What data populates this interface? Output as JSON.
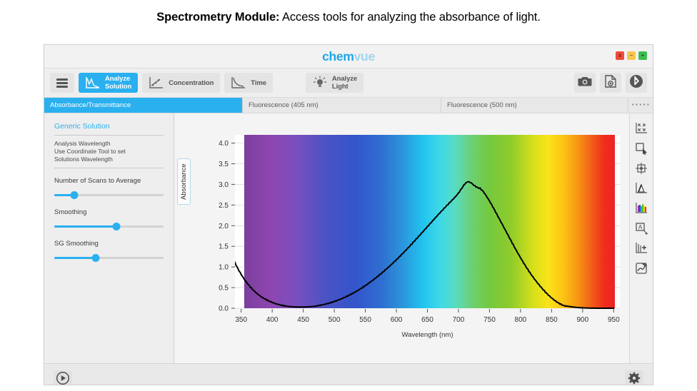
{
  "caption": {
    "bold": "Spectrometry Module:",
    "rest": " Access tools for analyzing the absorbance of light."
  },
  "window": {
    "brand_part1": "chem",
    "brand_part2": "vue",
    "controls": {
      "close": "x",
      "minimize": "–",
      "maximize": "+"
    }
  },
  "toolbar": {
    "menu_label": "",
    "buttons": [
      {
        "label": "Analyze\nSolution",
        "icon": "absorbance-curve-icon",
        "active": true
      },
      {
        "label": "Concentration",
        "icon": "scatter-trend-icon",
        "active": false
      },
      {
        "label": "Time",
        "icon": "decay-curve-icon",
        "active": false
      },
      {
        "label": "Analyze\nLight",
        "icon": "lightbulb-icon",
        "active": false
      }
    ],
    "right_buttons": [
      {
        "name": "camera-icon",
        "label": ""
      },
      {
        "name": "document-camera-icon",
        "label": ""
      },
      {
        "name": "bluetooth-icon",
        "label": ""
      }
    ]
  },
  "tabs": [
    {
      "label": "Absorbance/Transmittance",
      "active": true
    },
    {
      "label": "Fluorescence (405 nm)",
      "active": false
    },
    {
      "label": "Fluorescence (500 nm)",
      "active": false
    }
  ],
  "tab_grip": "▪▪▪▪▪",
  "sidebar": {
    "title": "Generic Solution",
    "note": "Analysis Wavelength\nUse Coordinate Tool to  set\nSolutions Wavelength",
    "sliders": [
      {
        "label": "Number of Scans to Average",
        "value": 18
      },
      {
        "label": "Smoothing",
        "value": 57
      },
      {
        "label": "SG Smoothing",
        "value": 38
      }
    ]
  },
  "rail": [
    {
      "name": "zoom-extents-icon"
    },
    {
      "name": "select-region-icon"
    },
    {
      "name": "coordinate-tool-icon"
    },
    {
      "name": "peak-analysis-icon"
    },
    {
      "name": "spectrum-bars-icon"
    },
    {
      "name": "annotation-icon"
    },
    {
      "name": "add-axis-icon"
    },
    {
      "name": "export-graph-icon"
    }
  ],
  "statusbar": {
    "play_label": "",
    "settings_label": ""
  },
  "chart_data": {
    "type": "line",
    "title": "",
    "xlabel": "Wavelength (nm)",
    "ylabel": "Absorbance",
    "xlim": [
      340,
      960
    ],
    "ylim": [
      0.0,
      4.2
    ],
    "xticks": [
      350,
      400,
      450,
      500,
      550,
      600,
      650,
      700,
      750,
      800,
      850,
      900,
      950
    ],
    "yticks": [
      "0.0",
      "0.5",
      "1.0",
      "1.5",
      "2.0",
      "2.5",
      "3.0",
      "3.5",
      "4.0"
    ],
    "grid": false,
    "legend": "none",
    "background": "visible-spectrum-gradient",
    "spectrum_span_nm": [
      352,
      952
    ],
    "series": [
      {
        "name": "Absorbance",
        "color": "#000000",
        "x": [
          340,
          345,
          350,
          355,
          360,
          365,
          370,
          375,
          380,
          385,
          390,
          395,
          400,
          405,
          410,
          415,
          420,
          425,
          430,
          435,
          440,
          445,
          450,
          455,
          460,
          465,
          470,
          475,
          480,
          485,
          490,
          495,
          500,
          505,
          510,
          515,
          520,
          525,
          530,
          535,
          540,
          545,
          550,
          555,
          560,
          565,
          570,
          575,
          580,
          585,
          590,
          595,
          600,
          605,
          610,
          615,
          620,
          625,
          630,
          635,
          640,
          645,
          650,
          655,
          660,
          665,
          670,
          675,
          680,
          685,
          690,
          695,
          700,
          705,
          710,
          715,
          720,
          725,
          730,
          735,
          740,
          745,
          750,
          755,
          760,
          765,
          770,
          775,
          780,
          785,
          790,
          795,
          800,
          805,
          810,
          815,
          820,
          825,
          830,
          835,
          840,
          845,
          850,
          855,
          860,
          865,
          870,
          880,
          890,
          900,
          910,
          920,
          930,
          940,
          950
        ],
        "y": [
          1.1,
          0.95,
          0.82,
          0.7,
          0.6,
          0.51,
          0.43,
          0.36,
          0.3,
          0.25,
          0.21,
          0.17,
          0.14,
          0.11,
          0.09,
          0.07,
          0.055,
          0.045,
          0.038,
          0.033,
          0.03,
          0.029,
          0.029,
          0.031,
          0.035,
          0.041,
          0.05,
          0.062,
          0.077,
          0.094,
          0.113,
          0.135,
          0.16,
          0.187,
          0.216,
          0.248,
          0.283,
          0.32,
          0.36,
          0.402,
          0.447,
          0.495,
          0.545,
          0.598,
          0.653,
          0.71,
          0.77,
          0.832,
          0.896,
          0.962,
          1.03,
          1.1,
          1.172,
          1.246,
          1.322,
          1.4,
          1.48,
          1.56,
          1.642,
          1.724,
          1.808,
          1.892,
          1.976,
          2.06,
          2.144,
          2.228,
          2.31,
          2.39,
          2.468,
          2.546,
          2.622,
          2.7,
          2.79,
          2.9,
          3.01,
          3.07,
          3.045,
          2.98,
          2.93,
          2.905,
          2.83,
          2.72,
          2.6,
          2.47,
          2.33,
          2.19,
          2.05,
          1.91,
          1.77,
          1.63,
          1.49,
          1.355,
          1.225,
          1.1,
          0.98,
          0.866,
          0.76,
          0.66,
          0.566,
          0.478,
          0.396,
          0.32,
          0.252,
          0.192,
          0.14,
          0.098,
          0.064,
          0.04,
          0.02,
          0.01,
          0.004,
          0.001,
          0.0,
          0.0,
          0.0,
          0.0,
          0.0
        ]
      }
    ]
  }
}
